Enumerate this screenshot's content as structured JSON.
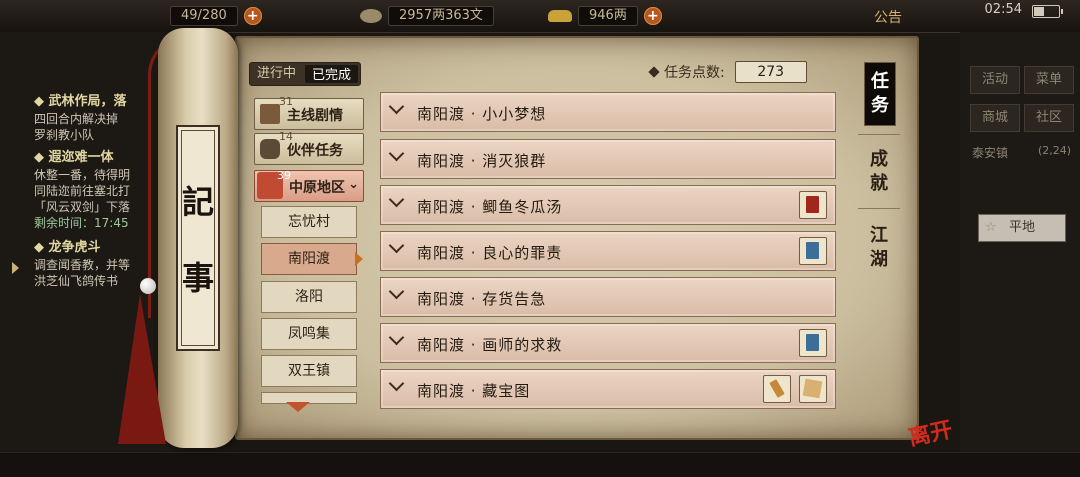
{
  "topbar": {
    "res1": "49/280",
    "money": "2957两363文",
    "gold": "946两",
    "notice": "公告",
    "clock": "02:54"
  },
  "leftlog": {
    "h1": "◆ 武林作局，落",
    "l1": "四回合内解决掉",
    "l2": "罗刹教小队",
    "h2": "◆ 遐迩难一体",
    "l3": "休整一番，待得明",
    "l4": "同陆迩前往塞北打",
    "l5": "「风云双剑」下落",
    "l6": "剩余时间：17:45",
    "h3": "◆ 龙争虎斗",
    "l7": "调查闻香教，并等",
    "l8": "洪芝仙飞鸽传书"
  },
  "rightbg": {
    "b1": "活动",
    "b2": "菜单",
    "b3": "商城",
    "b4": "社区",
    "loc": "泰安镇",
    "coords": "(2,24)",
    "flat": "平地"
  },
  "scroll": {
    "char1": "記",
    "char2": "事"
  },
  "status": {
    "in_progress": "进行中",
    "completed": "已完成"
  },
  "points": {
    "label": "任务点数:",
    "value": "273"
  },
  "categories": {
    "main_story": {
      "label": "主线剧情",
      "count": "31"
    },
    "partner": {
      "label": "伙伴任务",
      "count": "14"
    },
    "region": {
      "label": "中原地区",
      "count": "39"
    }
  },
  "locations": [
    "忘忧村",
    "南阳渡",
    "洛阳",
    "凤鸣集",
    "双王镇"
  ],
  "quests": [
    "南阳渡 · 小小梦想",
    "南阳渡 · 消灭狼群",
    "南阳渡 · 鲫鱼冬瓜汤",
    "南阳渡 · 良心的罪责",
    "南阳渡 · 存货告急",
    "南阳渡 · 画师的求救",
    "南阳渡 · 藏宝图"
  ],
  "tabs": {
    "task": "任务",
    "achievement": "成就",
    "world": "江湖"
  },
  "logo": "离开",
  "colors": {
    "accent": "#c9721a",
    "selected_row": "#d9a98e",
    "region_red": "#c04a32"
  }
}
